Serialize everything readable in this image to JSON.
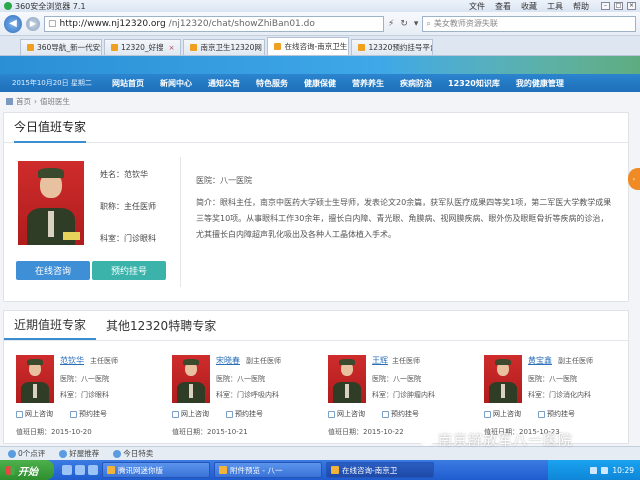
{
  "browser": {
    "app_title": "360安全浏览器 7.1",
    "menus": [
      "文件",
      "查看",
      "收藏",
      "工具",
      "帮助"
    ],
    "url_host": "http://www.nj12320.org",
    "url_path": "/nj12320/chat/showZhiBan01.do",
    "search_placeholder": "美女教师资源失联",
    "tabs": [
      {
        "label": "360导航_新一代安全"
      },
      {
        "label": "12320_好搜"
      },
      {
        "label": "南京卫生12320网"
      },
      {
        "label": "在线咨询-南京卫生"
      },
      {
        "label": "12320预约挂号平台"
      }
    ],
    "status": {
      "count": "0个点评",
      "speed": "好屋推荐",
      "daily": "今日特卖"
    }
  },
  "site": {
    "date": "2015年10月20日 星期二",
    "nav": [
      "网站首页",
      "新闻中心",
      "通知公告",
      "特色服务",
      "健康保健",
      "营养养生",
      "疾病防治",
      "12320知识库",
      "我的健康管理"
    ],
    "breadcrumb": [
      "首页",
      "值班医生"
    ]
  },
  "today": {
    "title": "今日值班专家",
    "name_label": "姓名：范钦华",
    "title_label": "职称：主任医师",
    "dept_label": "科室：门诊眼科",
    "hospital": "医院：八一医院",
    "bio": "简介：眼科主任，南京中医药大学硕士生导师，发表论文20余篇，获军队医疗成果四等奖1项，第二军医大学教学成果三等奖10项。从事眼科工作30余年，擅长白内障、青光眼、角膜病、视网膜疾病、眼外伤及眼眶骨折等疾病的诊治，尤其擅长白内障超声乳化吸出及各种人工晶体植入手术。",
    "consult_btn": "在线咨询",
    "appoint_btn": "预约挂号"
  },
  "recent": {
    "tab_active": "近期值班专家",
    "tab_other": "其他12320特聘专家",
    "hospital_prefix": "医院：八一医院",
    "consult_label": "网上咨询",
    "appoint_label": "预约挂号",
    "doctors": [
      {
        "name": "范钦华",
        "title": "主任医师",
        "dept": "科室：门诊眼科",
        "date": "值班日期：2015-10-20"
      },
      {
        "name": "宋晓春",
        "title": "副主任医师",
        "dept": "科室：门诊呼吸内科",
        "date": "值班日期：2015-10-21"
      },
      {
        "name": "王辉",
        "title": "主任医师",
        "dept": "科室：门诊肿瘤内科",
        "date": "值班日期：2015-10-22"
      },
      {
        "name": "黄宝鑫",
        "title": "副主任医师",
        "dept": "科室：门诊消化内科",
        "date": "值班日期：2015-10-23"
      }
    ]
  },
  "taskbar": {
    "start": "开始",
    "tasks": [
      "腾讯网迷你版",
      "附件预览 - 八一",
      "在线咨询-南京卫"
    ],
    "clock": "10:29"
  },
  "watermark": "南京解放军八一医院"
}
